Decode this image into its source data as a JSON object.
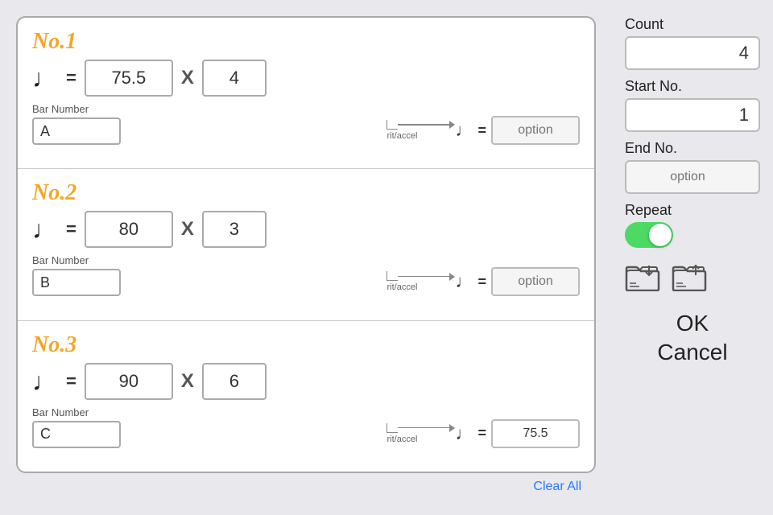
{
  "sections": [
    {
      "id": "no1",
      "title": "No.1",
      "tempo": "75.5",
      "multiplier": "X",
      "count": "4",
      "bar_label": "Bar Number",
      "bar_value": "A",
      "rit_label": "rit/accel",
      "rit_option": "option"
    },
    {
      "id": "no2",
      "title": "No.2",
      "tempo": "80",
      "multiplier": "X",
      "count": "3",
      "bar_label": "Bar Number",
      "bar_value": "B",
      "rit_label": "rit/accel",
      "rit_option": "option"
    },
    {
      "id": "no3",
      "title": "No.3",
      "tempo": "90",
      "multiplier": "X",
      "count": "6",
      "bar_label": "Bar Number",
      "bar_value": "C",
      "rit_label": "rit/accel",
      "rit_value": "75.5"
    }
  ],
  "clear_all": "Clear All",
  "sidebar": {
    "count_label": "Count",
    "count_value": "4",
    "start_label": "Start No.",
    "start_value": "1",
    "end_label": "End No.",
    "end_option": "option",
    "repeat_label": "Repeat",
    "ok_label": "OK",
    "cancel_label": "Cancel"
  }
}
